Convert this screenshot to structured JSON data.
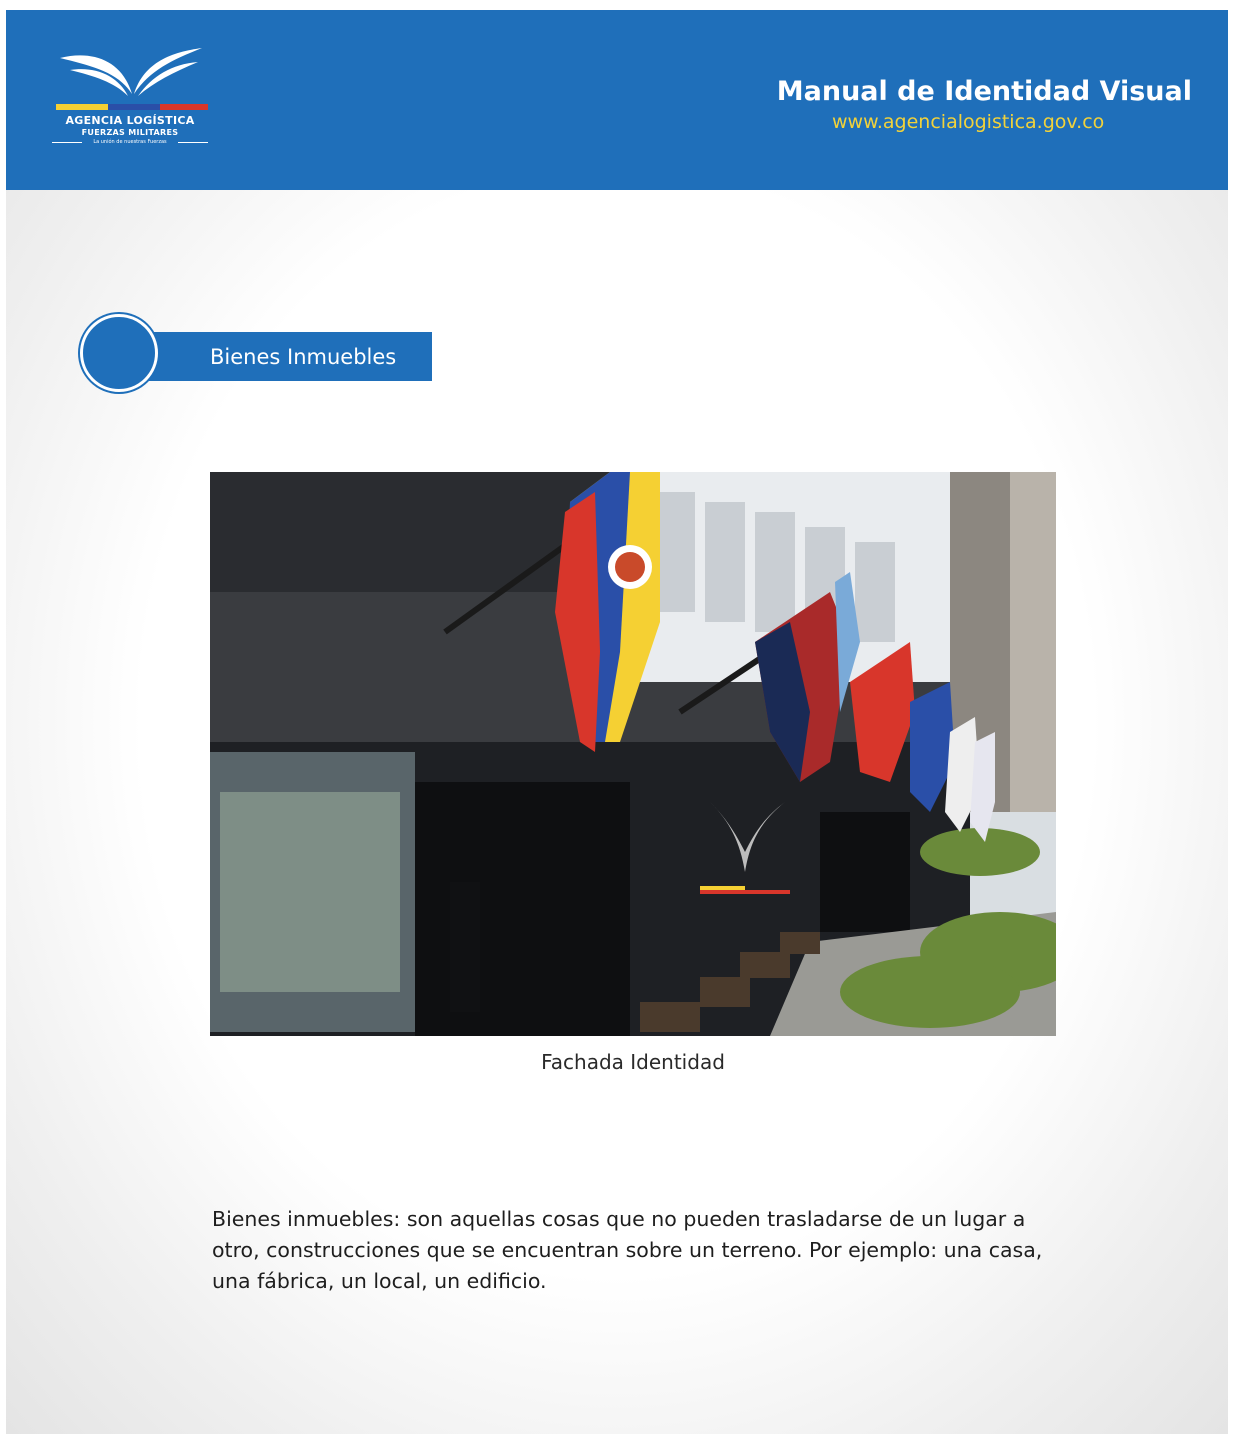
{
  "header": {
    "title": "Manual de Identidad Visual",
    "url": "www.agencialogistica.gov.co",
    "logo": {
      "name": "AGENCIA LOGÍSTICA",
      "subtitle": "FUERZAS MILITARES",
      "tagline": "La unión de nuestras Fuerzas"
    }
  },
  "section": {
    "label": "Bienes Inmuebles"
  },
  "figure": {
    "caption": "Fachada Identidad"
  },
  "body": {
    "paragraph": "Bienes inmuebles: son aquellas cosas que no pueden trasladarse de un lugar a otro, construcciones que se encuentran sobre un terreno. Por ejemplo: una casa, una fábrica, un local, un edificio."
  },
  "colors": {
    "brand_blue": "#1f6fba",
    "url_yellow": "#f2d23a",
    "flag_yellow": "#f5d033",
    "flag_blue": "#2a4fa8",
    "flag_red": "#d8362b"
  }
}
